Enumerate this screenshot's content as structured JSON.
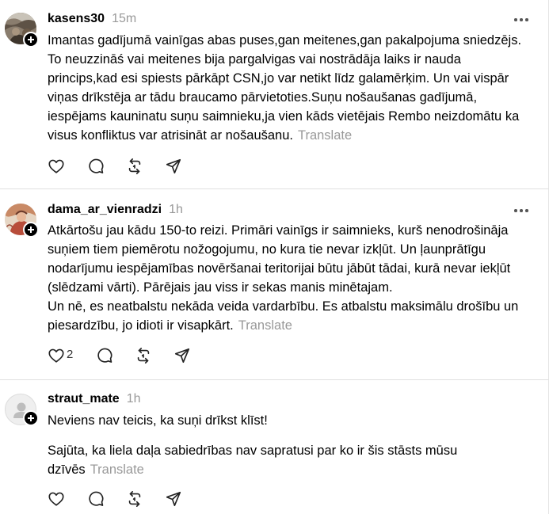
{
  "posts": [
    {
      "username": "kasens30",
      "time": "15m",
      "paragraphs": [
        "Imantas gadījumā vainīgas abas puses,gan meitenes,gan pakalpojuma sniedzējs.\nTo neuzzināś vai meitenes bija pargalvigas vai nostrādāja laiks ir nauda\nprincips,kad esi spiests pārkāpt CSN,jo var netikt līdz galamērķim. Un vai vispār\nviņas drīkstēja ar tādu braucamo pārvietoties.Suņu nošaušanas gadījumā,\niespējams kauninatu suņu saimnieku,ja vien kāds vietējais Rembo neizdomātu ka\nvisus konfliktus var atrisināt ar nošaušanu."
      ],
      "translate": "Translate",
      "likes": ""
    },
    {
      "username": "dama_ar_vienradzi",
      "time": "1h",
      "paragraphs": [
        "Atkārtošu jau kādu 150-to reizi. Primāri vainīgs ir saimnieks, kurš nenodrošināja\nsuņiem tiem piemērotu nožogojumu, no kura tie nevar izkļūt. Un ļaunprātīgu\nnodarījumu iespējamības novēršanai teritorijai būtu jābūt tādai, kurā nevar iekļūt\n(slēdzami vārti). Pārējais jau viss ir sekas manis minētajam.\nUn nē, es neatbalstu nekāda veida vardarbību. Es atbalstu maksimālu drošību un\npiesardzību, jo idioti ir visapkārt."
      ],
      "translate": "Translate",
      "likes": "2"
    },
    {
      "username": "straut_mate",
      "time": "1h",
      "paragraphs": [
        "Neviens nav teicis, ka suņi drīkst klīst!",
        "Sajūta, ka liela daļa sabiedrības nav sapratusi par ko ir šis stāsts mūsu\ndzīvēs"
      ],
      "translate": "Translate",
      "likes": ""
    }
  ],
  "icons": {
    "like": "heart-icon",
    "reply": "comment-icon",
    "repost": "repost-icon",
    "share": "send-icon",
    "more": "more-icon",
    "follow": "plus-icon"
  },
  "colors": {
    "text": "#000000",
    "secondary": "#999999",
    "divider": "#e0e0e0"
  }
}
